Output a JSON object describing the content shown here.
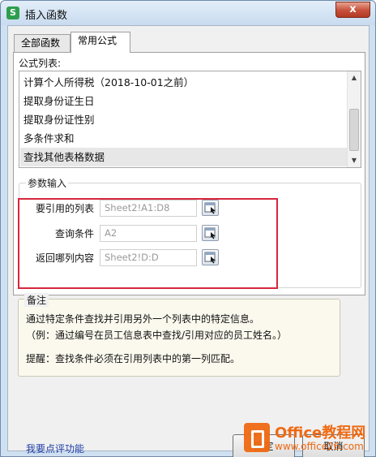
{
  "window": {
    "title": "插入函数",
    "app_icon": "S",
    "close_glyph": "x"
  },
  "tabs": [
    {
      "label": "全部函数",
      "active": false
    },
    {
      "label": "常用公式",
      "active": true
    }
  ],
  "formula_list": {
    "label": "公式列表:",
    "items": [
      {
        "label": "计算个人所得税（2018-10-01之前）",
        "selected": false
      },
      {
        "label": "提取身份证生日",
        "selected": false
      },
      {
        "label": "提取身份证性别",
        "selected": false
      },
      {
        "label": "多条件求和",
        "selected": false
      },
      {
        "label": "查找其他表格数据",
        "selected": true
      }
    ]
  },
  "params": {
    "title": "参数输入",
    "fields": [
      {
        "label": "要引用的列表",
        "value": "Sheet2!A1:D8"
      },
      {
        "label": "查询条件",
        "value": "A2"
      },
      {
        "label": "返回哪列内容",
        "value": "Sheet2!D:D"
      }
    ]
  },
  "notes": {
    "title": "备注",
    "lines": [
      "通过特定条件查找并引用另外一个列表中的特定信息。",
      "（例：通过编号在员工信息表中查找/引用对应的员工姓名。）",
      "提醒：查找条件必须在引用列表中的第一列匹配。"
    ]
  },
  "feedback_link": "我要点评功能",
  "buttons": {
    "ok": "确定",
    "cancel": "取消"
  },
  "watermark": {
    "brand": "Office教程网",
    "url": "www.office26.com"
  },
  "colors": {
    "highlight_box": "#d7263d",
    "link": "#1f3fa8",
    "watermark": "#ef6a13"
  }
}
